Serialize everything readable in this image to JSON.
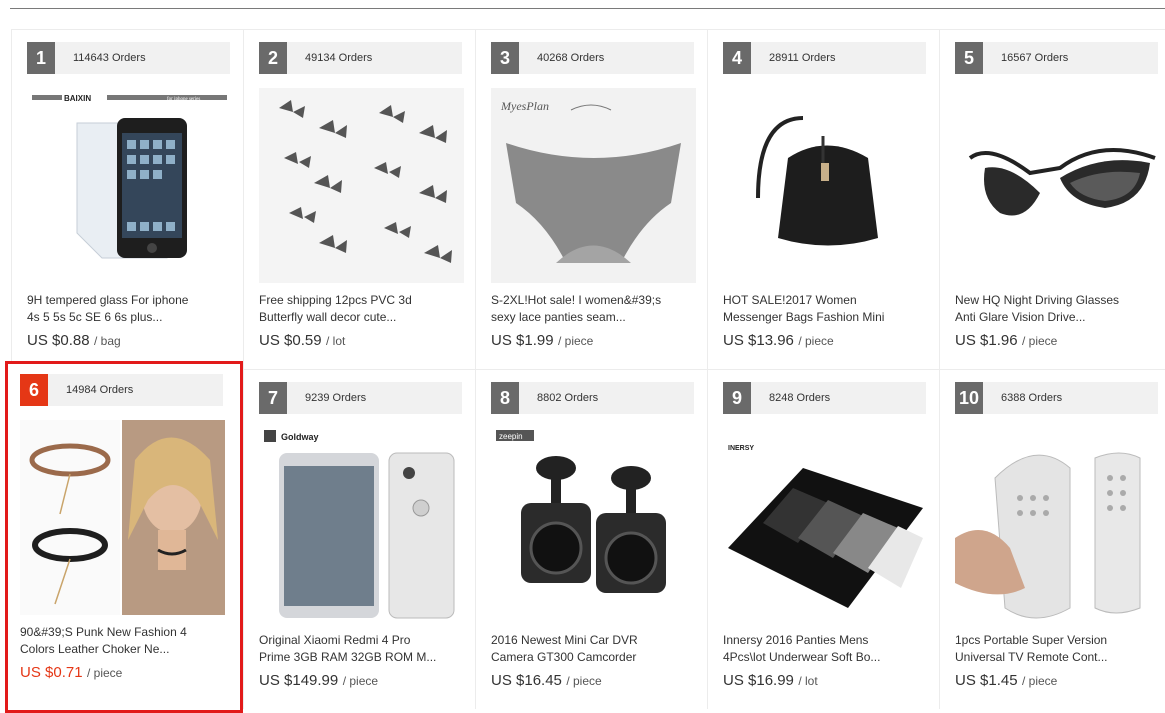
{
  "products": [
    {
      "rank": "1",
      "orders": "114643 Orders",
      "title1": "9H tempered glass For iphone",
      "title2": "4s 5 5s 5c SE 6 6s plus...",
      "price": "US $0.88",
      "unit": "/ bag",
      "image_label": "BAIXIN",
      "image_caption": "for iphone series",
      "icon": "phone-screen-protector-image"
    },
    {
      "rank": "2",
      "orders": "49134 Orders",
      "title1": "Free shipping 12pcs PVC 3d",
      "title2": "Butterfly wall decor cute...",
      "price": "US $0.59",
      "unit": "/ lot",
      "icon": "butterfly-decor-image"
    },
    {
      "rank": "3",
      "orders": "40268 Orders",
      "title1": "S-2XL!Hot sale! I women&#39;s",
      "title2": "sexy lace panties seam...",
      "price": "US $1.99",
      "unit": "/ piece",
      "image_label": "MyesPlan",
      "icon": "lace-panties-image"
    },
    {
      "rank": "4",
      "orders": "28911 Orders",
      "title1": "HOT SALE!2017 Women",
      "title2": "Messenger Bags Fashion Mini",
      "price": "US $13.96",
      "unit": "/ piece",
      "icon": "messenger-bag-image"
    },
    {
      "rank": "5",
      "orders": "16567 Orders",
      "title1": "New HQ Night Driving Glasses",
      "title2": "Anti Glare Vision Drive...",
      "price": "US $1.96",
      "unit": "/ piece",
      "icon": "driving-glasses-image"
    },
    {
      "rank": "6",
      "orders": "14984 Orders",
      "title1": "90&#39;S Punk New Fashion 4",
      "title2": "Colors Leather Choker Ne...",
      "price": "US $0.71",
      "unit": "/ piece",
      "icon": "choker-necklace-image",
      "highlighted": true
    },
    {
      "rank": "7",
      "orders": "9239 Orders",
      "title1": "Original Xiaomi Redmi 4 Pro",
      "title2": "Prime 3GB RAM 32GB ROM M...",
      "price": "US $149.99",
      "unit": "/ piece",
      "image_label": "Goldway",
      "icon": "smartphone-image"
    },
    {
      "rank": "8",
      "orders": "8802 Orders",
      "title1": "2016 Newest Mini Car DVR",
      "title2": "Camera GT300 Camcorder",
      "price": "US $16.45",
      "unit": "/ piece",
      "image_label": "zeepin",
      "icon": "car-dvr-camera-image"
    },
    {
      "rank": "9",
      "orders": "8248 Orders",
      "title1": "Innersy 2016 Panties Mens",
      "title2": "4Pcs\\lot Underwear Soft Bo...",
      "price": "US $16.99",
      "unit": "/ lot",
      "image_label": "INERSY",
      "icon": "mens-underwear-image"
    },
    {
      "rank": "10",
      "orders": "6388 Orders",
      "title1": "1pcs Portable Super Version",
      "title2": "Universal TV Remote Cont...",
      "price": "US $1.45",
      "unit": "/ piece",
      "icon": "tv-remote-image"
    }
  ],
  "colors": {
    "highlight": "#e21a1a",
    "rank_badge": "#6a6a6a",
    "rank_badge_active": "#e53716"
  }
}
